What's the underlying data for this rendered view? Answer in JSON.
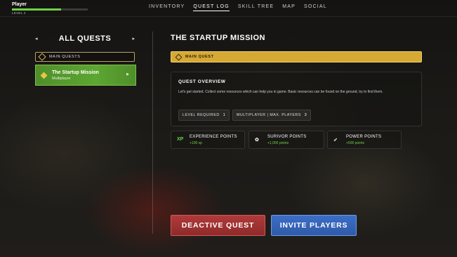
{
  "player": {
    "name": "Player",
    "level_label": "LEVEL 2",
    "xp_progress": 0.65
  },
  "nav": {
    "tabs": [
      {
        "label": "INVENTORY",
        "active": false
      },
      {
        "label": "QUEST LOG",
        "active": true
      },
      {
        "label": "SKILL TREE",
        "active": false
      },
      {
        "label": "MAP",
        "active": false
      },
      {
        "label": "SOCIAL",
        "active": false
      }
    ]
  },
  "quest_list": {
    "header": "ALL QUESTS",
    "prev_arrow": "◂",
    "next_arrow": "▸",
    "category": "MAIN QUESTS",
    "items": [
      {
        "name": "The Startup Mission",
        "type": "Multiplayer",
        "play": "▶"
      }
    ]
  },
  "quest_detail": {
    "title": "THE STARTUP MISSION",
    "tag": "MAIN QUEST",
    "overview": {
      "heading": "QUEST OVERVIEW",
      "description": "Let's get started. Collect some resources which can help you in game. Basic resources can be found on the ground, try to find them.",
      "level_label": "LEVEL REQUIRED",
      "level_value": "1",
      "players_label": "MULTIPLAYER | MAX. PLAYERS",
      "players_value": "3"
    },
    "rewards": [
      {
        "icon_text": "XP",
        "icon": "xp-icon",
        "title": "EXPERIENCE POINTS",
        "amount": "+100 xp"
      },
      {
        "icon_text": "✿",
        "icon": "survivor-icon",
        "title": "SURIVOR POINTS",
        "amount": "+1,000 points"
      },
      {
        "icon_text": "➶",
        "icon": "power-icon",
        "title": "POWER POINTS",
        "amount": "+500 points"
      }
    ]
  },
  "actions": {
    "deactivate_label": "DEACTIVE QUEST",
    "invite_label": "INVITE PLAYERS"
  },
  "colors": {
    "accent_green": "#6fcf45",
    "quest_tag_gold": "#d6a935",
    "deactivate_red": "#a33434",
    "invite_blue": "#3563b8"
  }
}
